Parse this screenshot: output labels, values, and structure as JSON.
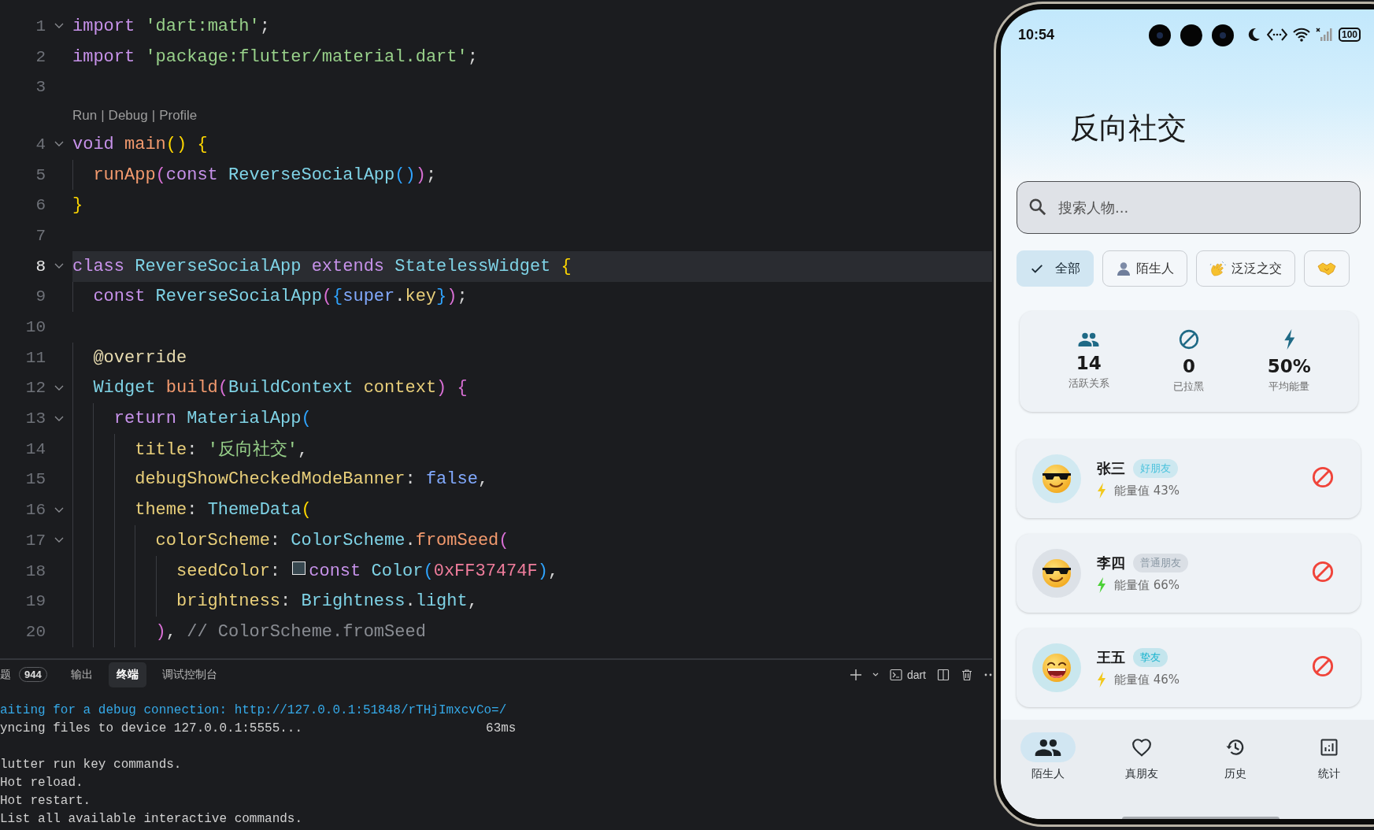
{
  "editor": {
    "lines": [
      {
        "kind": "code",
        "number": "1",
        "foldable": true,
        "current": false,
        "tokens": [
          {
            "text": "import",
            "kind": "kw"
          },
          {
            "text": " 'dart:math'",
            "kind": "str"
          },
          {
            "text": ";",
            "kind": "plain"
          }
        ]
      },
      {
        "kind": "code",
        "number": "2",
        "foldable": false,
        "current": false,
        "tokens": [
          {
            "text": "import",
            "kind": "kw"
          },
          {
            "text": " 'package:flutter/material.dart'",
            "kind": "str"
          },
          {
            "text": ";",
            "kind": "plain"
          }
        ]
      },
      {
        "kind": "code",
        "number": "3",
        "foldable": false,
        "current": false
      },
      {
        "kind": "codelens",
        "links": [
          "Run",
          "Debug",
          "Profile"
        ],
        "separator": "|"
      },
      {
        "kind": "code",
        "number": "4",
        "foldable": true,
        "current": false,
        "tokens": [
          {
            "text": "void",
            "kind": "kw"
          },
          {
            "text": " main",
            "kind": "fn"
          },
          {
            "text": "()",
            "kind": "b1"
          },
          {
            "text": " {",
            "kind": "b1"
          }
        ]
      },
      {
        "kind": "code",
        "number": "5",
        "foldable": false,
        "current": false,
        "tokens": [
          {
            "text": "  runApp",
            "kind": "fn"
          },
          {
            "text": "(",
            "kind": "b2"
          },
          {
            "text": "const",
            "kind": "kw"
          },
          {
            "text": " ReverseSocialApp",
            "kind": "type"
          },
          {
            "text": "()",
            "kind": "b3"
          },
          {
            "text": ")",
            "kind": "b2"
          },
          {
            "text": ";",
            "kind": "plain"
          }
        ]
      },
      {
        "kind": "code",
        "number": "6",
        "foldable": false,
        "current": false,
        "tokens": [
          {
            "text": "}",
            "kind": "b1"
          }
        ]
      },
      {
        "kind": "code",
        "number": "7",
        "foldable": false,
        "current": false
      },
      {
        "kind": "code",
        "number": "8",
        "foldable": true,
        "current": true,
        "tokens": [
          {
            "text": "class",
            "kind": "kw"
          },
          {
            "text": " ReverseSocialApp",
            "kind": "type"
          },
          {
            "text": " extends",
            "kind": "kw"
          },
          {
            "text": " StatelessWidget",
            "kind": "type"
          },
          {
            "text": " {",
            "kind": "b1"
          }
        ]
      },
      {
        "kind": "code",
        "number": "9",
        "foldable": false,
        "current": false,
        "tokens": [
          {
            "text": "  const",
            "kind": "kw"
          },
          {
            "text": " ReverseSocialApp",
            "kind": "type"
          },
          {
            "text": "(",
            "kind": "b2"
          },
          {
            "text": "{",
            "kind": "b3"
          },
          {
            "text": "super",
            "kind": "const"
          },
          {
            "text": ".",
            "kind": "plain"
          },
          {
            "text": "key",
            "kind": "prop"
          },
          {
            "text": "}",
            "kind": "b3"
          },
          {
            "text": ")",
            "kind": "b2"
          },
          {
            "text": ";",
            "kind": "plain"
          }
        ]
      },
      {
        "kind": "code",
        "number": "10",
        "foldable": false,
        "current": false
      },
      {
        "kind": "code",
        "number": "11",
        "foldable": false,
        "current": false,
        "tokens": [
          {
            "text": "  @override",
            "kind": "anno"
          }
        ]
      },
      {
        "kind": "code",
        "number": "12",
        "foldable": true,
        "current": false,
        "tokens": [
          {
            "text": "  Widget",
            "kind": "type"
          },
          {
            "text": " build",
            "kind": "fn"
          },
          {
            "text": "(",
            "kind": "b2"
          },
          {
            "text": "BuildContext",
            "kind": "type"
          },
          {
            "text": " context",
            "kind": "prop"
          },
          {
            "text": ")",
            "kind": "b2"
          },
          {
            "text": " {",
            "kind": "b2"
          }
        ]
      },
      {
        "kind": "code",
        "number": "13",
        "foldable": true,
        "current": false,
        "tokens": [
          {
            "text": "    return",
            "kind": "kw"
          },
          {
            "text": " MaterialApp",
            "kind": "type"
          },
          {
            "text": "(",
            "kind": "b3"
          }
        ]
      },
      {
        "kind": "code",
        "number": "14",
        "foldable": false,
        "current": false,
        "tokens": [
          {
            "text": "      title",
            "kind": "prop"
          },
          {
            "text": ": ",
            "kind": "plain"
          },
          {
            "text": "'反向社交'",
            "kind": "str"
          },
          {
            "text": ",",
            "kind": "plain"
          }
        ]
      },
      {
        "kind": "code",
        "number": "15",
        "foldable": false,
        "current": false,
        "tokens": [
          {
            "text": "      debugShowCheckedModeBanner",
            "kind": "prop"
          },
          {
            "text": ": ",
            "kind": "plain"
          },
          {
            "text": "false",
            "kind": "const"
          },
          {
            "text": ",",
            "kind": "plain"
          }
        ]
      },
      {
        "kind": "code",
        "number": "16",
        "foldable": true,
        "current": false,
        "tokens": [
          {
            "text": "      theme",
            "kind": "prop"
          },
          {
            "text": ": ",
            "kind": "plain"
          },
          {
            "text": "ThemeData",
            "kind": "type"
          },
          {
            "text": "(",
            "kind": "b1"
          }
        ]
      },
      {
        "kind": "code",
        "number": "17",
        "foldable": true,
        "current": false,
        "tokens": [
          {
            "text": "        colorScheme",
            "kind": "prop"
          },
          {
            "text": ": ",
            "kind": "plain"
          },
          {
            "text": "ColorScheme",
            "kind": "type"
          },
          {
            "text": ".",
            "kind": "plain"
          },
          {
            "text": "fromSeed",
            "kind": "fn"
          },
          {
            "text": "(",
            "kind": "b2"
          }
        ]
      },
      {
        "kind": "code",
        "number": "18",
        "foldable": false,
        "current": false,
        "tokens": [
          {
            "text": "          seedColor",
            "kind": "prop"
          },
          {
            "text": ": ",
            "kind": "plain"
          },
          {
            "kind": "swatch",
            "color": "#37474f"
          },
          {
            "text": "const",
            "kind": "kw"
          },
          {
            "text": " Color",
            "kind": "type"
          },
          {
            "text": "(",
            "kind": "b3"
          },
          {
            "text": "0xFF37474F",
            "kind": "num"
          },
          {
            "text": ")",
            "kind": "b3"
          },
          {
            "text": ",",
            "kind": "plain"
          }
        ]
      },
      {
        "kind": "code",
        "number": "19",
        "foldable": false,
        "current": false,
        "tokens": [
          {
            "text": "          brightness",
            "kind": "prop"
          },
          {
            "text": ": ",
            "kind": "plain"
          },
          {
            "text": "Brightness",
            "kind": "type"
          },
          {
            "text": ".",
            "kind": "plain"
          },
          {
            "text": "light",
            "kind": "type"
          },
          {
            "text": ",",
            "kind": "plain"
          }
        ]
      },
      {
        "kind": "code",
        "number": "20",
        "foldable": false,
        "current": false,
        "tokens": [
          {
            "text": "        )",
            "kind": "b2"
          },
          {
            "text": ", ",
            "kind": "plain"
          },
          {
            "text": "// ColorScheme.fromSeed",
            "kind": "comment"
          }
        ]
      }
    ]
  },
  "panel": {
    "tabs": [
      {
        "label": "题",
        "badge": "944",
        "selected": false
      },
      {
        "label": "输出",
        "selected": false
      },
      {
        "label": "终端",
        "selected": true
      },
      {
        "label": "调试控制台",
        "selected": false
      }
    ],
    "terminal_profile": "dart",
    "terminal_lines": [
      {
        "text": "aiting for a debug connection: http://127.0.0.1:51848/rTHjImxcvCo=/",
        "kind": "info"
      },
      {
        "text": "yncing files to device 127.0.0.1:5555...",
        "kind": "plain",
        "timing": "63ms"
      },
      {
        "kind": "blank"
      },
      {
        "text": "lutter run key commands.",
        "kind": "plain"
      },
      {
        "text": "Hot reload.",
        "kind": "plain"
      },
      {
        "text": "Hot restart.",
        "kind": "plain"
      },
      {
        "text": "List all available interactive commands.",
        "kind": "plain"
      }
    ]
  },
  "phone": {
    "status_bar": {
      "time": "10:54",
      "battery": "100"
    },
    "title": "反向社交",
    "search": {
      "placeholder": "搜索人物..."
    },
    "chips": [
      {
        "label": "全部",
        "kind": "plain",
        "selected": true
      },
      {
        "label": "陌生人",
        "kind": "person",
        "selected": false
      },
      {
        "label": "泛泛之交",
        "kind": "wave",
        "selected": false
      },
      {
        "kind": "handshake",
        "selected": false
      }
    ],
    "stats": [
      {
        "kind": "people",
        "value": "14",
        "label": "活跃关系"
      },
      {
        "kind": "block",
        "value": "0",
        "label": "已拉黑"
      },
      {
        "kind": "bolt",
        "value": "50%",
        "label": "平均能量"
      }
    ],
    "people": [
      {
        "kind": "sunglasses",
        "name": "张三",
        "tag": {
          "label": "好朋友",
          "color": "#4cc3dd"
        },
        "energy": {
          "reading": "能量值 43%",
          "color": "#f2c81b"
        }
      },
      {
        "kind": "sunglasses",
        "name": "李四",
        "tag": {
          "label": "普通朋友",
          "color": "#8a98a4"
        },
        "energy": {
          "reading": "能量值 66%",
          "color": "#4cd137"
        }
      },
      {
        "kind": "laughing",
        "name": "王五",
        "tag": {
          "label": "挚友",
          "color": "#1fb5cf"
        },
        "energy": {
          "reading": "能量值 46%",
          "color": "#f2c81b"
        }
      }
    ],
    "nav": [
      {
        "kind": "people",
        "label": "陌生人",
        "selected": true
      },
      {
        "kind": "heart",
        "label": "真朋友",
        "selected": false
      },
      {
        "kind": "history",
        "label": "历史",
        "selected": false
      },
      {
        "kind": "chart",
        "label": "统计",
        "selected": false
      }
    ]
  }
}
